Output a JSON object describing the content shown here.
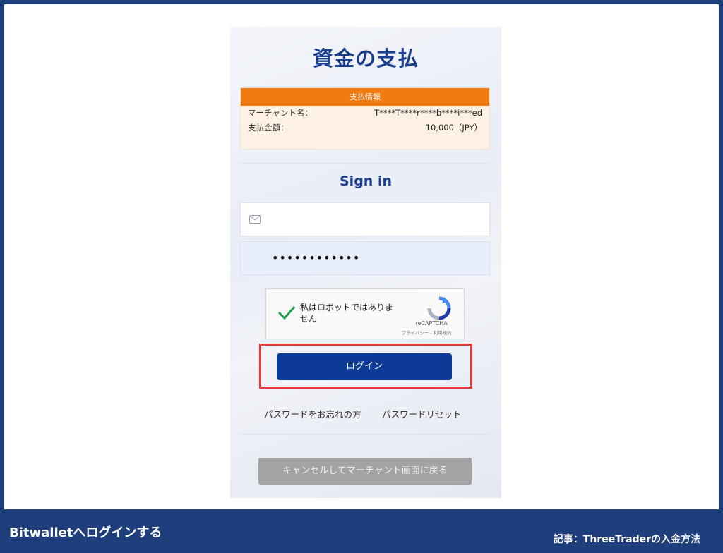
{
  "page": {
    "title": "資金の支払"
  },
  "payment_info": {
    "header": "支払情報",
    "merchant_label": "マーチャント名：",
    "merchant_value": "T****T****r****b****i***ed",
    "amount_label": "支払金額：",
    "amount_value": "10,000（JPY）"
  },
  "signin": {
    "title": "Sign in",
    "email_value": "",
    "password_value": "••••••••••••"
  },
  "recaptcha": {
    "label": "私はロボットではありません",
    "brand": "reCAPTCHA",
    "links": "プライバシー - 利用規約",
    "checked": true
  },
  "actions": {
    "login_label": "ログイン",
    "forgot_password": "パスワードをお忘れの方",
    "password_reset": "パスワードリセット",
    "cancel_label": "キャンセルしてマーチャント画面に戻る"
  },
  "captions": {
    "left": "Bitwalletへログインする",
    "right": "記事：ThreeTraderの入金方法"
  },
  "colors": {
    "accent_orange": "#f07a10",
    "primary_blue": "#0d3a96",
    "highlight_red": "#e33b3b",
    "frame_blue": "#1f3f7c"
  },
  "icons": {
    "email": "envelope-icon",
    "check": "checkmark-icon",
    "recaptcha": "recaptcha-logo-icon"
  }
}
